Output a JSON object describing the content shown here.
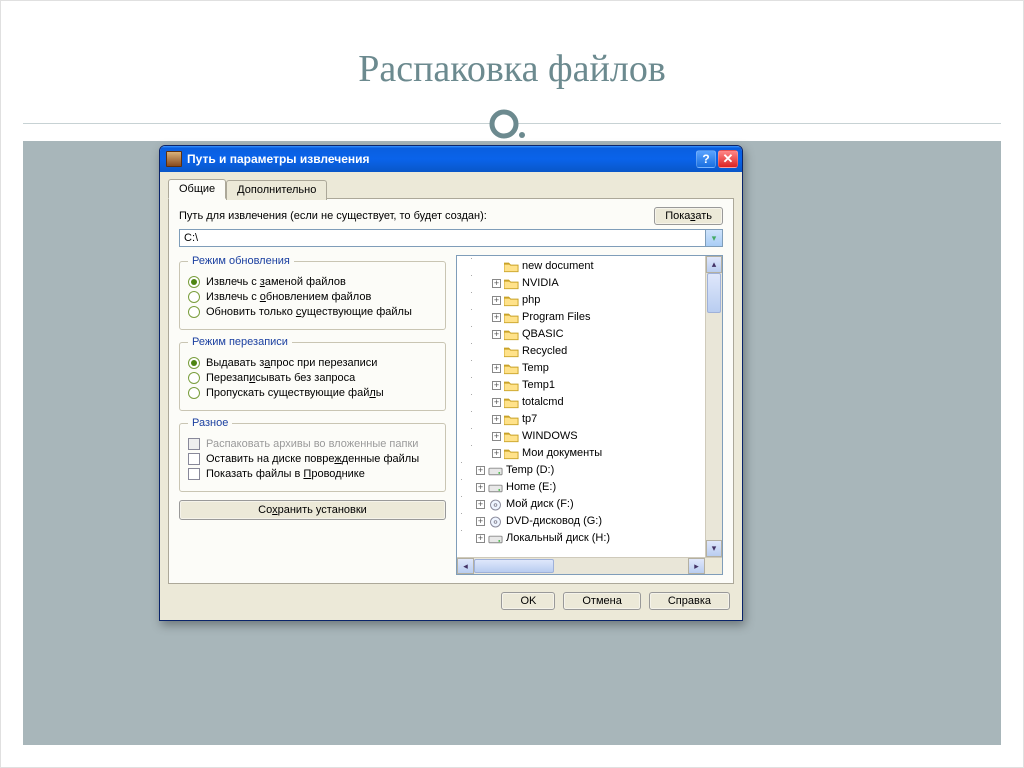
{
  "slide": {
    "title": "Распаковка файлов"
  },
  "dialog": {
    "title": "Путь и параметры извлечения",
    "tabs": {
      "general": "Общие",
      "advanced": "Дополнительно"
    },
    "path_label": "Путь для извлечения (если не существует, то будет создан):",
    "show_btn": "Показать",
    "path_value": "C:\\",
    "groups": {
      "update": {
        "legend": "Режим обновления",
        "opt1": "Извлечь с заменой файлов",
        "opt2": "Извлечь с обновлением файлов",
        "opt3": "Обновить только существующие файлы"
      },
      "overwrite": {
        "legend": "Режим перезаписи",
        "opt1": "Выдавать запрос при перезаписи",
        "opt2": "Перезаписывать без запроса",
        "opt3": "Пропускать существующие файлы"
      },
      "misc": {
        "legend": "Разное",
        "chk1": "Распаковать архивы во вложенные папки",
        "chk2": "Оставить на диске поврежденные файлы",
        "chk3": "Показать файлы в Проводнике"
      }
    },
    "save_btn": "Сохранить установки",
    "tree": [
      {
        "expand": "",
        "icon": "folder",
        "label": "new document",
        "depth": 2
      },
      {
        "expand": "+",
        "icon": "folder",
        "label": "NVIDIA",
        "depth": 2
      },
      {
        "expand": "+",
        "icon": "folder",
        "label": "php",
        "depth": 2
      },
      {
        "expand": "+",
        "icon": "folder",
        "label": "Program Files",
        "depth": 2
      },
      {
        "expand": "+",
        "icon": "folder",
        "label": "QBASIC",
        "depth": 2
      },
      {
        "expand": "",
        "icon": "folder",
        "label": "Recycled",
        "depth": 2
      },
      {
        "expand": "+",
        "icon": "folder",
        "label": "Temp",
        "depth": 2
      },
      {
        "expand": "+",
        "icon": "folder",
        "label": "Temp1",
        "depth": 2
      },
      {
        "expand": "+",
        "icon": "folder",
        "label": "totalcmd",
        "depth": 2
      },
      {
        "expand": "+",
        "icon": "folder",
        "label": "tp7",
        "depth": 2
      },
      {
        "expand": "+",
        "icon": "folder",
        "label": "WINDOWS",
        "depth": 2
      },
      {
        "expand": "+",
        "icon": "folder",
        "label": "Мои документы",
        "depth": 2
      },
      {
        "expand": "+",
        "icon": "drive",
        "label": "Temp (D:)",
        "depth": 1
      },
      {
        "expand": "+",
        "icon": "drive",
        "label": "Home (E:)",
        "depth": 1
      },
      {
        "expand": "+",
        "icon": "cd",
        "label": "Мой диск (F:)",
        "depth": 1
      },
      {
        "expand": "+",
        "icon": "cd",
        "label": "DVD-дисковод (G:)",
        "depth": 1
      },
      {
        "expand": "+",
        "icon": "drive",
        "label": "Локальный диск (H:)",
        "depth": 1
      }
    ],
    "buttons": {
      "ok": "OK",
      "cancel": "Отмена",
      "help": "Справка"
    }
  }
}
